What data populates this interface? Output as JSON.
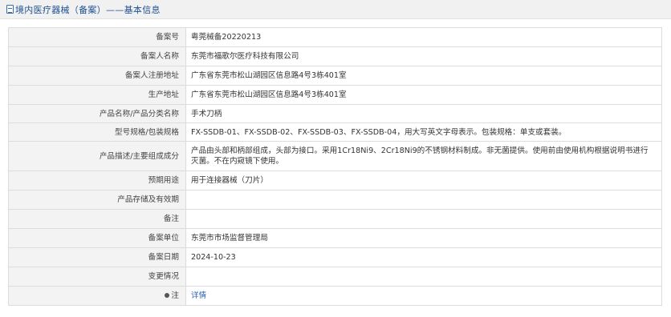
{
  "header": {
    "title": "境内医疗器械（备案）——基本信息"
  },
  "rows": [
    {
      "label": "备案号",
      "value": "粤莞械备20220213"
    },
    {
      "label": "备案人名称",
      "value": "东莞市福歌尔医疗科技有限公司"
    },
    {
      "label": "备案人注册地址",
      "value": "广东省东莞市松山湖园区信息路4号3栋401室"
    },
    {
      "label": "生产地址",
      "value": "广东省东莞市松山湖园区信息路4号3栋401室"
    },
    {
      "label": "产品名称/产品分类名称",
      "value": "手术刀柄"
    },
    {
      "label": "型号规格/包装规格",
      "value": "FX-SSDB-01、FX-SSDB-02、FX-SSDB-03、FX-SSDB-04，用大写英文字母表示。包装规格：单支或套装。"
    },
    {
      "label": "产品描述/主要组成成分",
      "value": "产品由头部和柄部组成，头部为接口。采用1Cr18Ni9、2Cr18Ni9的不锈钢材料制成。非无菌提供。使用前由使用机构根据说明书进行灭菌。不在内窥镜下使用。"
    },
    {
      "label": "预期用途",
      "value": "用于连接器械（刀片）"
    },
    {
      "label": "产品存储及有效期",
      "value": ""
    },
    {
      "label": "备注",
      "value": ""
    },
    {
      "label": "备案单位",
      "value": "东莞市市场监督管理局"
    },
    {
      "label": "备案日期",
      "value": "2024-10-23"
    },
    {
      "label": "变更情况",
      "value": ""
    },
    {
      "label": "注",
      "value": "详情"
    }
  ]
}
